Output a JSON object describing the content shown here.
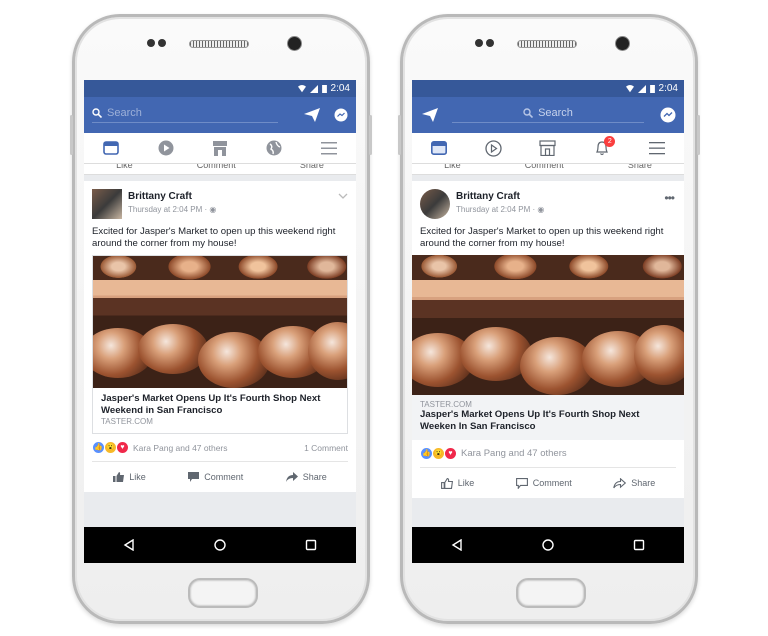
{
  "colors": {
    "brand": "#4267b2",
    "status": "#365899",
    "active_tab": "#4267b2",
    "badge": "#fa3e3e"
  },
  "phones": [
    {
      "status": {
        "time": "2:04"
      },
      "search": {
        "placeholder": "Search"
      },
      "tabs": [
        "news-feed",
        "video",
        "marketplace",
        "globe",
        "menu"
      ],
      "ghost_actions": {
        "like": "Like",
        "comment": "Comment",
        "share": "Share"
      },
      "post": {
        "author": "Brittany Craft",
        "timestamp": "Thursday at 2:04 PM",
        "privacy": "·",
        "text": "Excited for Jasper's Market to open up this weekend right around the corner from my house!",
        "link_title": "Jasper's Market Opens Up It's Fourth Shop Next Weekend in San Francisco",
        "link_domain": "TASTER.COM",
        "reactions_text": "Kara Pang and 47 others",
        "comments": "1 Comment",
        "actions": {
          "like": "Like",
          "comment": "Comment",
          "share": "Share"
        }
      }
    },
    {
      "status": {
        "time": "2:04"
      },
      "search": {
        "placeholder": "Search"
      },
      "tabs": [
        "news-feed",
        "video",
        "marketplace",
        "notifications",
        "menu"
      ],
      "notification_count": "2",
      "ghost_actions": {
        "like": "Like",
        "comment": "Comment",
        "share": "Share"
      },
      "post": {
        "author": "Brittany Craft",
        "timestamp": "Thursday at 2:04 PM",
        "privacy": "·",
        "text": "Excited for Jasper's Market to open up this weekend right around the corner from my house!",
        "link_domain": "TASTER.COM",
        "link_title": "Jasper's Market Opens Up It's Fourth Shop Next Weeken In San Francisco",
        "reactions_text": "Kara Pang and 47 others",
        "actions": {
          "like": "Like",
          "comment": "Comment",
          "share": "Share"
        }
      }
    }
  ]
}
